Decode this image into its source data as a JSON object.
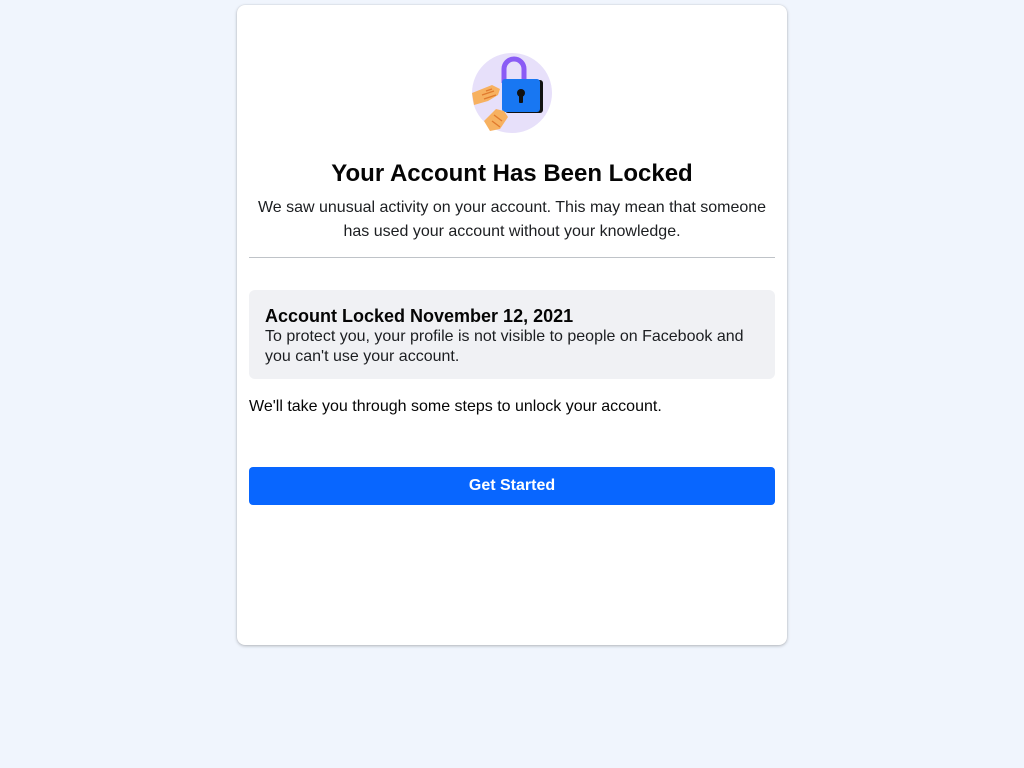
{
  "illustration": {
    "icon": "locked-padlock-with-hands-icon",
    "colors": {
      "circle": "#e7e0fa",
      "lock_body": "#1877f2",
      "lock_shackle": "#8a5cf5",
      "hand": "#f7b160"
    }
  },
  "heading": {
    "title": "Your Account Has Been Locked",
    "subtitle": "We saw unusual activity on your account. This may mean that someone has used your account without your knowledge."
  },
  "notice": {
    "title": "Account Locked November 12, 2021",
    "body": "To protect you, your profile is not visible to people on Facebook and you can't use your account."
  },
  "steps_text": "We'll take you through some steps to unlock your account.",
  "actions": {
    "get_started_label": "Get Started"
  },
  "colors": {
    "page_background": "#f0f5fd",
    "card_background": "#ffffff",
    "notice_background": "#f0f1f4",
    "primary_button": "#0866ff"
  }
}
